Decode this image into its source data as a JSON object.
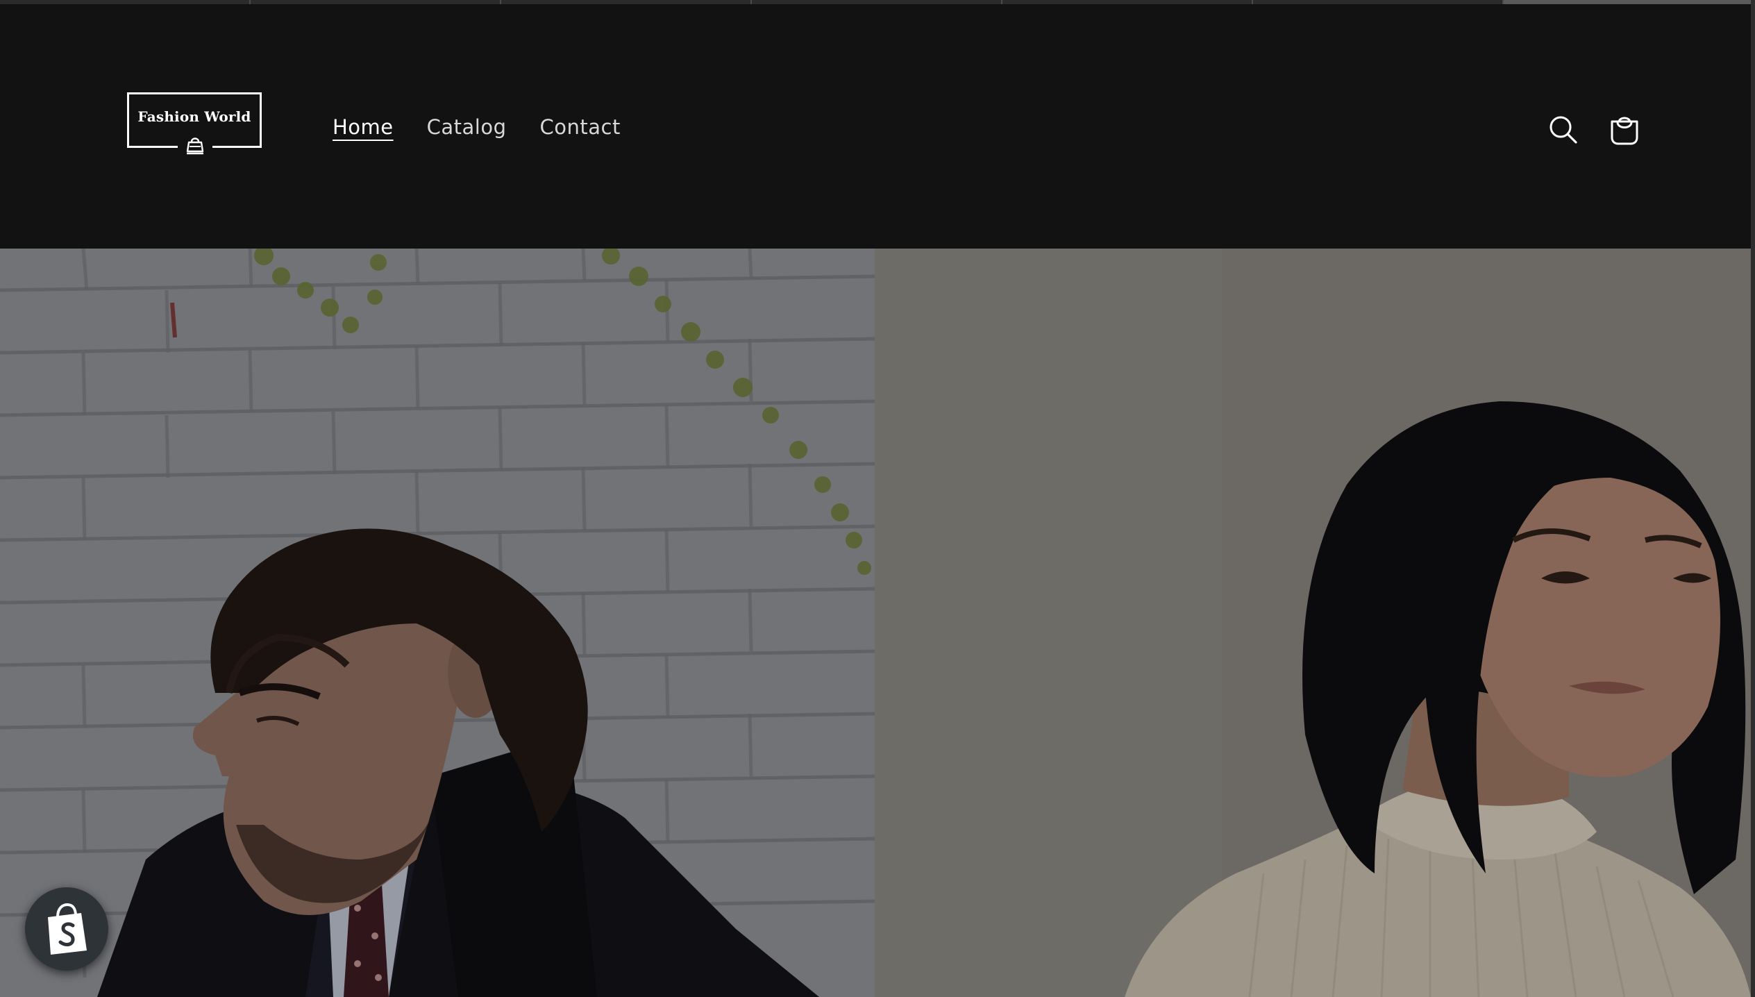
{
  "store": {
    "name": "Fashion World"
  },
  "nav": {
    "items": [
      {
        "label": "Home",
        "active": true
      },
      {
        "label": "Catalog",
        "active": false
      },
      {
        "label": "Contact",
        "active": false
      }
    ]
  },
  "header_icons": {
    "search": "search-icon",
    "cart": "cart-icon"
  },
  "hero": {
    "images": [
      {
        "subject": "man-in-dark-coat-against-brick-wall",
        "side": "left"
      },
      {
        "subject": "woman-in-cream-sweater",
        "side": "right"
      }
    ]
  },
  "badges": {
    "shopify": "shopify-bag-icon"
  },
  "colors": {
    "header_bg": "#121212",
    "nav_text": "#d8d8d8",
    "nav_active": "#ffffff"
  }
}
